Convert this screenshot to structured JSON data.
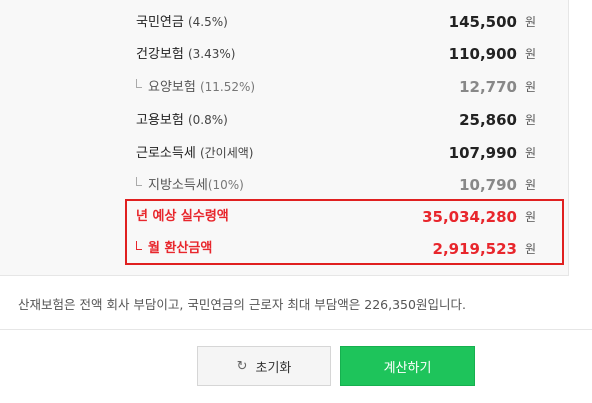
{
  "rows": [
    {
      "label": "국민연금",
      "pct": "(4.5%)",
      "value": "145,500",
      "unit": "원"
    },
    {
      "label": "건강보험",
      "pct": "(3.43%)",
      "value": "110,900",
      "unit": "원"
    },
    {
      "label": "요양보험",
      "pct": "(11.52%)",
      "value": "12,770",
      "unit": "원"
    },
    {
      "label": "고용보험",
      "pct": "(0.8%)",
      "value": "25,860",
      "unit": "원"
    },
    {
      "label": "근로소득세",
      "pct": "(간이세액)",
      "value": "107,990",
      "unit": "원"
    },
    {
      "label": "지방소득세",
      "pct": "(10%)",
      "value": "10,790",
      "unit": "원"
    }
  ],
  "results": [
    {
      "label": "년 예상 실수령액",
      "value": "35,034,280",
      "unit": "원"
    },
    {
      "label": "월 환산금액",
      "value": "2,919,523",
      "unit": "원"
    }
  ],
  "note": "산재보험은 전액 회사 부담이고, 국민연금의 근로자 최대 부담액은 226,350원입니다.",
  "buttons": {
    "reset_icon": "↻",
    "reset_label": "초기화",
    "calc_label": "계산하기"
  },
  "colors": {
    "accent_red": "#e8262c",
    "accent_green": "#1ec45b"
  }
}
